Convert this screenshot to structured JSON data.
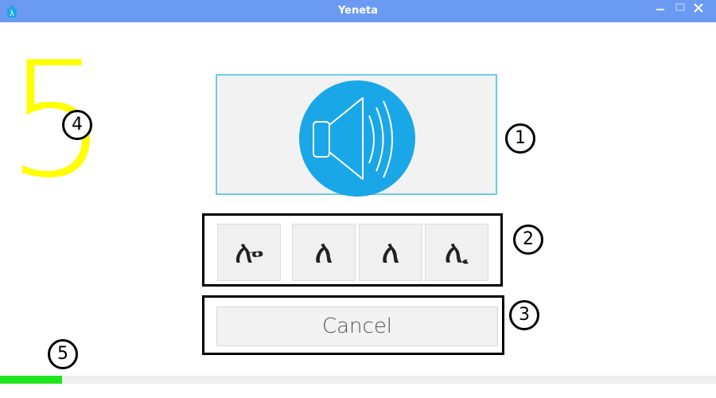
{
  "window": {
    "title": "Yeneta",
    "app_icon": "yeneta-logo-icon"
  },
  "countdown": {
    "value": "5",
    "color": "#ffff00"
  },
  "sound_button": {
    "icon": "speaker-icon",
    "color": "#1aa7e8"
  },
  "choices": [
    "ሎ",
    "ለ",
    "ለ",
    "ሊ"
  ],
  "cancel_label": "Cancel",
  "callouts": [
    "1",
    "2",
    "3",
    "4",
    "5"
  ],
  "progress": {
    "fraction": 0.087,
    "color": "#1ee51e"
  }
}
